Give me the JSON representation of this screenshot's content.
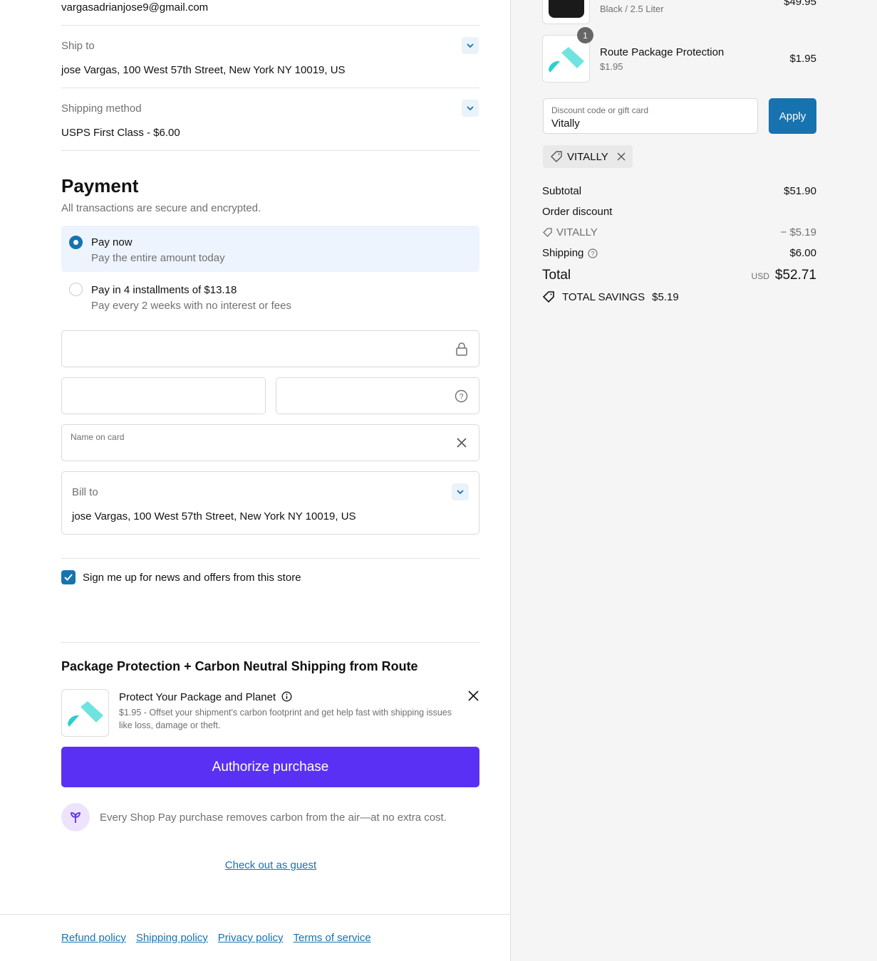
{
  "contact": {
    "email": "vargasadrianjose9@gmail.com"
  },
  "ship_to": {
    "label": "Ship to",
    "value": "jose Vargas, 100 West 57th Street, New York NY 10019, US"
  },
  "shipping_method": {
    "label": "Shipping method",
    "value": "USPS First Class - $6.00"
  },
  "payment": {
    "title": "Payment",
    "subtitle": "All transactions are secure and encrypted.",
    "options": [
      {
        "label": "Pay now",
        "sub": "Pay the entire amount today",
        "selected": true
      },
      {
        "label": "Pay in 4 installments of $13.18",
        "sub": "Pay every 2 weeks with no interest or fees",
        "selected": false
      }
    ],
    "name_on_card_placeholder": "Name on card",
    "bill_to": {
      "label": "Bill to",
      "value": "jose Vargas, 100 West 57th Street, New York NY 10019, US"
    }
  },
  "newsletter": {
    "label": "Sign me up for news and offers from this store",
    "checked": true
  },
  "route": {
    "title": "Package Protection + Carbon Neutral Shipping from Route",
    "item_title": "Protect Your Package and Planet",
    "item_desc": "$1.95 - Offset your shipment's carbon footprint and get help fast with shipping issues like loss, damage or theft."
  },
  "authorize_label": "Authorize purchase",
  "shop_pay_note": "Every Shop Pay purchase removes carbon from the air—at no extra cost.",
  "guest_link": "Check out as guest",
  "footer": [
    "Refund policy",
    "Shipping policy",
    "Privacy policy",
    "Terms of service"
  ],
  "summary": {
    "items": [
      {
        "variant": "Black / 2.5 Liter",
        "price": "$49.95"
      },
      {
        "name": "Route Package Protection",
        "sub": "$1.95",
        "price": "$1.95",
        "qty": "1"
      }
    ],
    "discount_label": "Discount code or gift card",
    "discount_value": "Vitally",
    "apply_label": "Apply",
    "applied_code": "VITALLY",
    "subtotal_label": "Subtotal",
    "subtotal": "$51.90",
    "order_discount_label": "Order discount",
    "discount_code": "VITALLY",
    "discount_amount": "− $5.19",
    "shipping_label": "Shipping",
    "shipping": "$6.00",
    "total_label": "Total",
    "currency": "USD",
    "total": "$52.71",
    "savings_label": "TOTAL SAVINGS",
    "savings": "$5.19"
  },
  "colors": {
    "accent": "#1773b0",
    "shop_pay": "#5a31f4",
    "route_teal": "#4fd6d6"
  }
}
